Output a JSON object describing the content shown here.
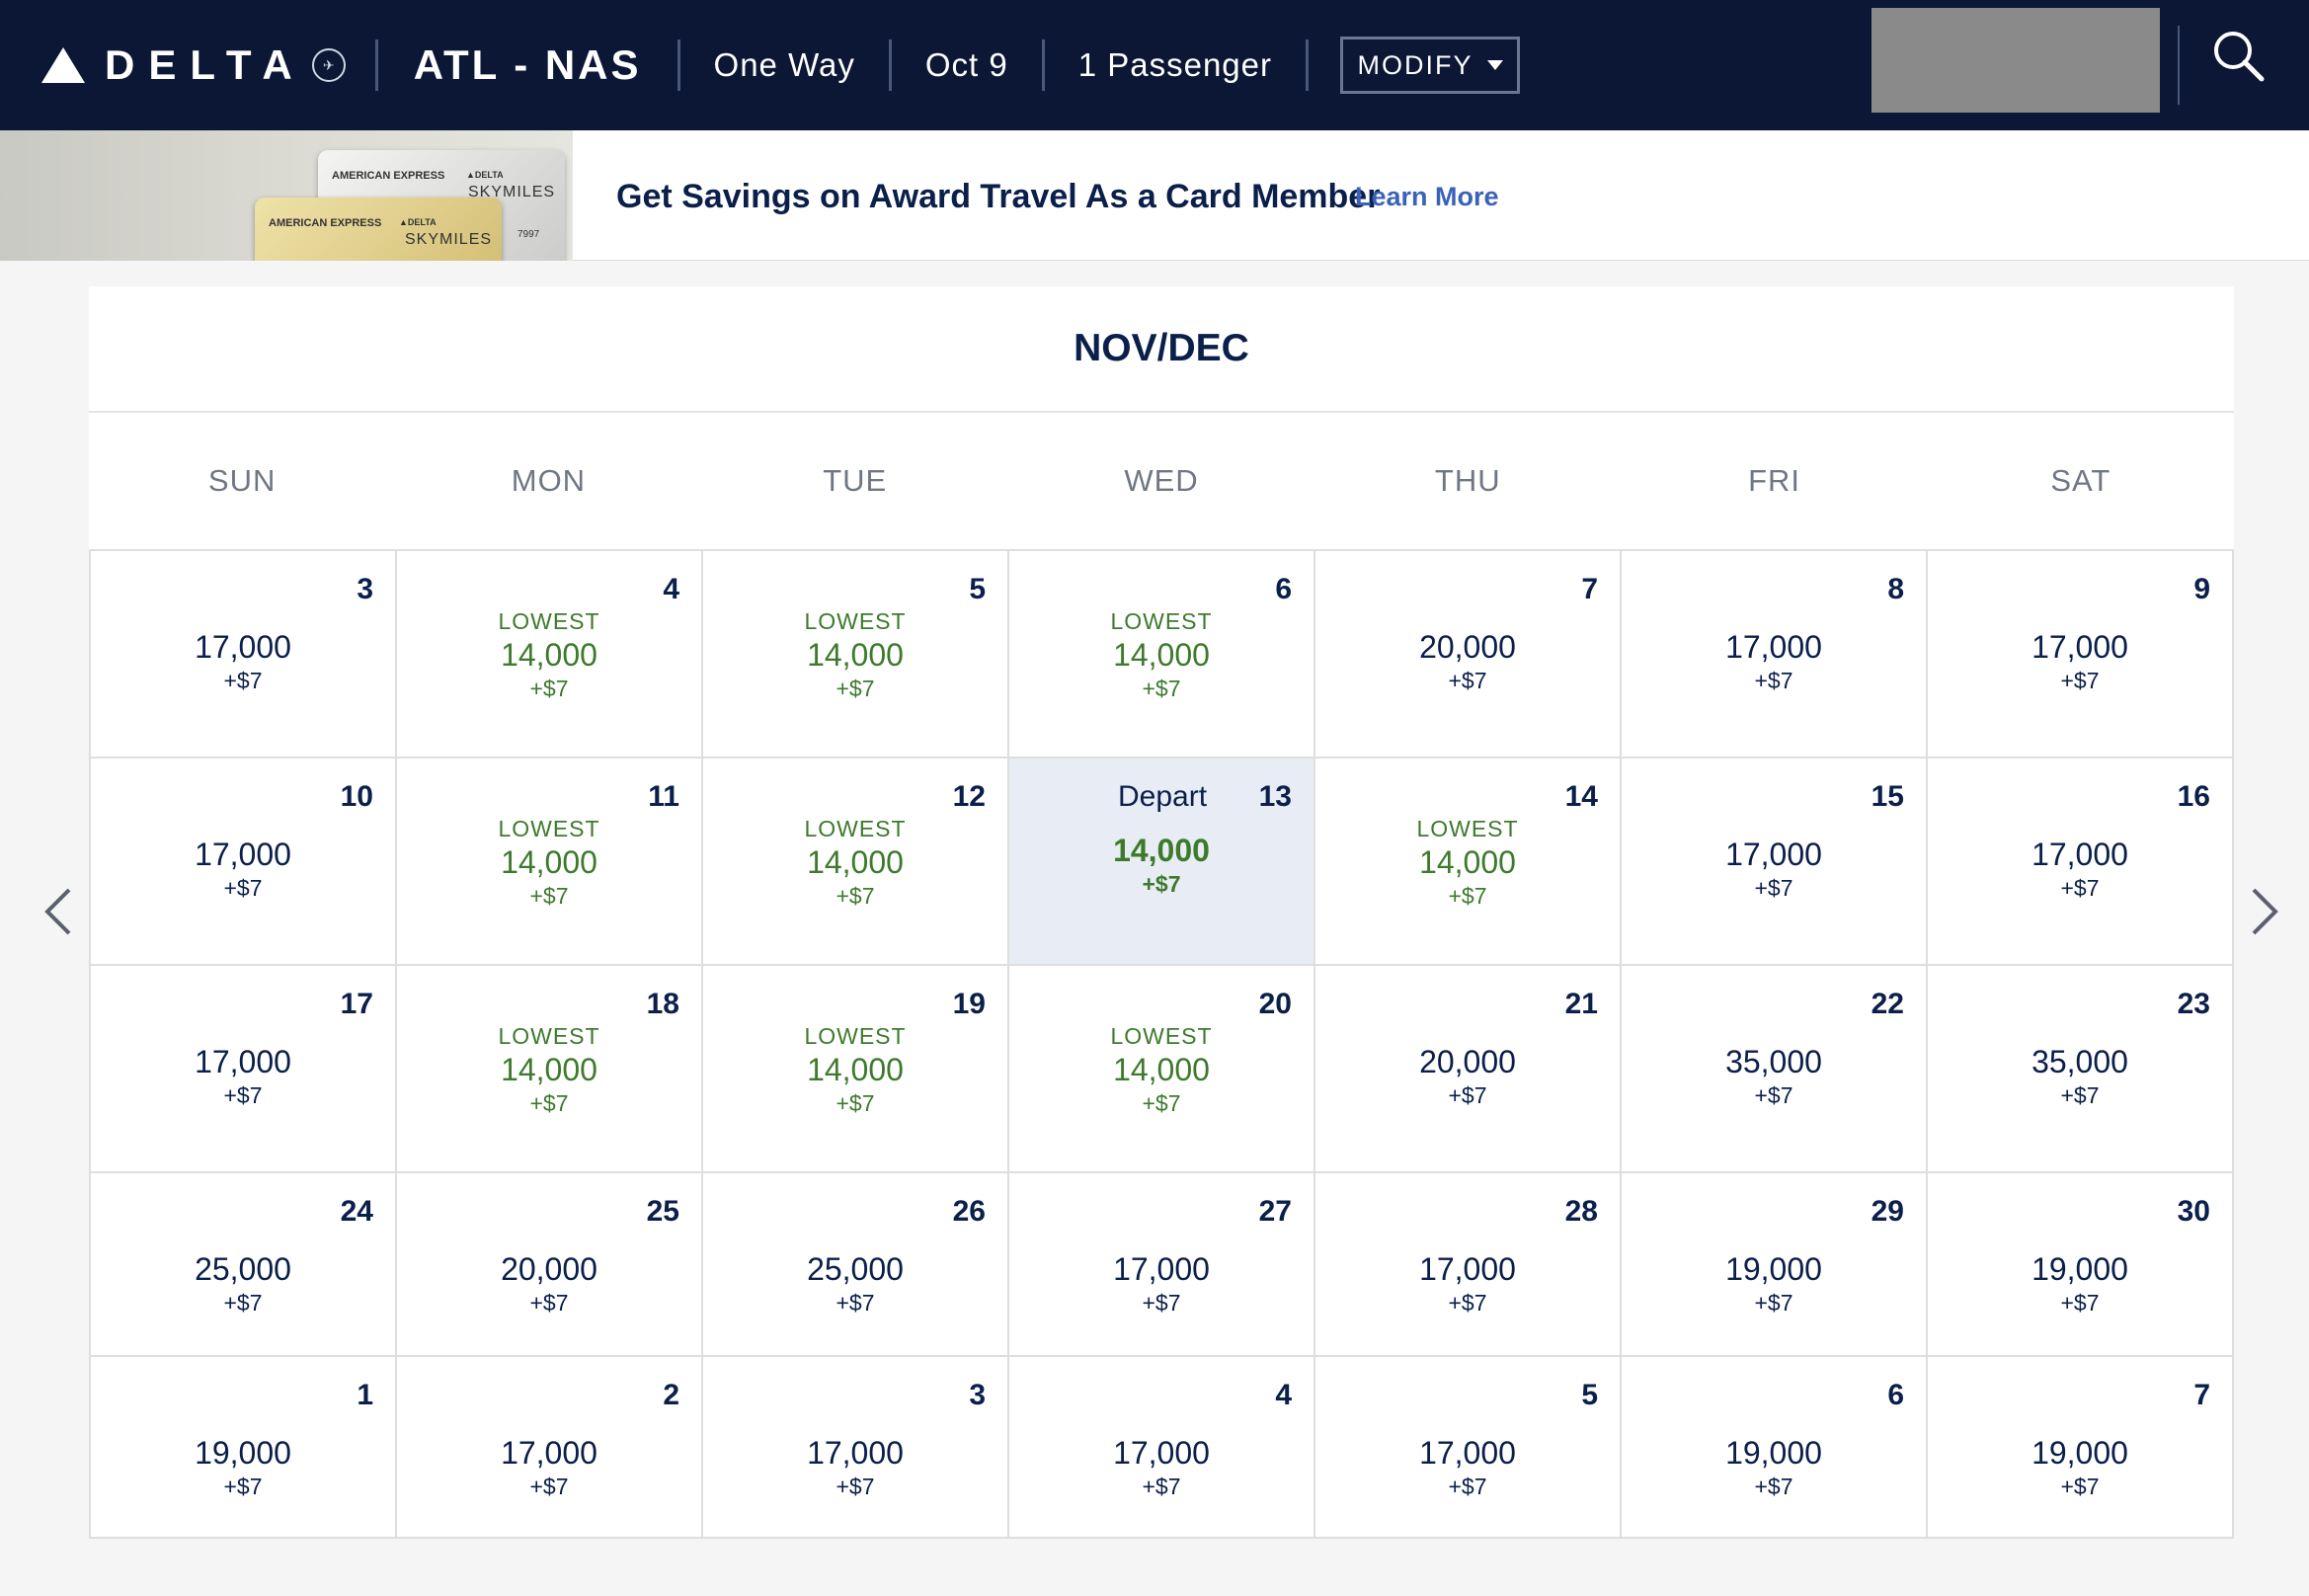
{
  "header": {
    "brand": "DELTA",
    "route": "ATL - NAS",
    "trip_type": "One Way",
    "date": "Oct 9",
    "passengers": "1 Passenger",
    "modify_label": "MODIFY",
    "icons": {
      "logo": "delta-widget-icon",
      "search": "search-icon",
      "modify": "caret-down-icon"
    }
  },
  "banner": {
    "title": "Get Savings on Award Travel As a Card Member",
    "link": "Learn More",
    "card_silver_issuer": "AMERICAN EXPRESS",
    "card_silver_brand": "SKYMILES",
    "card_gold_issuer": "AMERICAN EXPRESS",
    "card_gold_brand": "SKYMILES",
    "card_silver_delta": "▲DELTA",
    "card_gold_delta": "▲DELTA",
    "card_number_tail": "7997"
  },
  "calendar": {
    "title": "NOV/DEC",
    "days_of_week": [
      "SUN",
      "MON",
      "TUE",
      "WED",
      "THU",
      "FRI",
      "SAT"
    ],
    "lowest_label": "LOWEST",
    "depart_label": "Depart",
    "colors": {
      "lowest": "#3d7a2c",
      "selected_bg": "#e8ecf4",
      "text": "#0b1f4b"
    },
    "weeks": [
      [
        {
          "day": "3",
          "miles": "17,000",
          "fee": "+$7",
          "lowest": false
        },
        {
          "day": "4",
          "miles": "14,000",
          "fee": "+$7",
          "lowest": true
        },
        {
          "day": "5",
          "miles": "14,000",
          "fee": "+$7",
          "lowest": true
        },
        {
          "day": "6",
          "miles": "14,000",
          "fee": "+$7",
          "lowest": true
        },
        {
          "day": "7",
          "miles": "20,000",
          "fee": "+$7",
          "lowest": false
        },
        {
          "day": "8",
          "miles": "17,000",
          "fee": "+$7",
          "lowest": false
        },
        {
          "day": "9",
          "miles": "17,000",
          "fee": "+$7",
          "lowest": false
        }
      ],
      [
        {
          "day": "10",
          "miles": "17,000",
          "fee": "+$7",
          "lowest": false
        },
        {
          "day": "11",
          "miles": "14,000",
          "fee": "+$7",
          "lowest": true
        },
        {
          "day": "12",
          "miles": "14,000",
          "fee": "+$7",
          "lowest": true
        },
        {
          "day": "13",
          "miles": "14,000",
          "fee": "+$7",
          "lowest": false,
          "selected": true
        },
        {
          "day": "14",
          "miles": "14,000",
          "fee": "+$7",
          "lowest": true
        },
        {
          "day": "15",
          "miles": "17,000",
          "fee": "+$7",
          "lowest": false
        },
        {
          "day": "16",
          "miles": "17,000",
          "fee": "+$7",
          "lowest": false
        }
      ],
      [
        {
          "day": "17",
          "miles": "17,000",
          "fee": "+$7",
          "lowest": false
        },
        {
          "day": "18",
          "miles": "14,000",
          "fee": "+$7",
          "lowest": true
        },
        {
          "day": "19",
          "miles": "14,000",
          "fee": "+$7",
          "lowest": true
        },
        {
          "day": "20",
          "miles": "14,000",
          "fee": "+$7",
          "lowest": true
        },
        {
          "day": "21",
          "miles": "20,000",
          "fee": "+$7",
          "lowest": false
        },
        {
          "day": "22",
          "miles": "35,000",
          "fee": "+$7",
          "lowest": false
        },
        {
          "day": "23",
          "miles": "35,000",
          "fee": "+$7",
          "lowest": false
        }
      ],
      [
        {
          "day": "24",
          "miles": "25,000",
          "fee": "+$7",
          "lowest": false
        },
        {
          "day": "25",
          "miles": "20,000",
          "fee": "+$7",
          "lowest": false
        },
        {
          "day": "26",
          "miles": "25,000",
          "fee": "+$7",
          "lowest": false
        },
        {
          "day": "27",
          "miles": "17,000",
          "fee": "+$7",
          "lowest": false
        },
        {
          "day": "28",
          "miles": "17,000",
          "fee": "+$7",
          "lowest": false
        },
        {
          "day": "29",
          "miles": "19,000",
          "fee": "+$7",
          "lowest": false
        },
        {
          "day": "30",
          "miles": "19,000",
          "fee": "+$7",
          "lowest": false
        }
      ],
      [
        {
          "day": "1",
          "miles": "19,000",
          "fee": "+$7",
          "lowest": false
        },
        {
          "day": "2",
          "miles": "17,000",
          "fee": "+$7",
          "lowest": false
        },
        {
          "day": "3",
          "miles": "17,000",
          "fee": "+$7",
          "lowest": false
        },
        {
          "day": "4",
          "miles": "17,000",
          "fee": "+$7",
          "lowest": false
        },
        {
          "day": "5",
          "miles": "17,000",
          "fee": "+$7",
          "lowest": false
        },
        {
          "day": "6",
          "miles": "19,000",
          "fee": "+$7",
          "lowest": false
        },
        {
          "day": "7",
          "miles": "19,000",
          "fee": "+$7",
          "lowest": false
        }
      ]
    ],
    "nav_icons": {
      "prev": "chevron-left-icon",
      "next": "chevron-right-icon"
    }
  }
}
